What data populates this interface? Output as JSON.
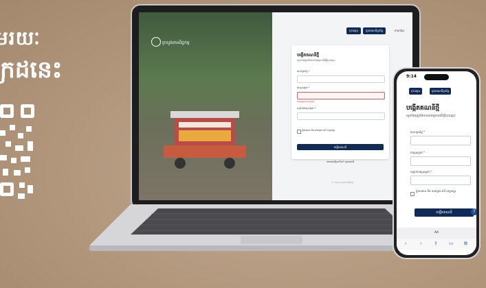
{
  "promo": {
    "line1": "មរយៈ",
    "line2": "ក្រដនេះ"
  },
  "laptop": {
    "photo_header": "ក្រសួងពាណិជ្ជកម្ម",
    "topbar": {
      "btn_primary": "ចុះឈ្មោះ",
      "btn_secondary": "ចូលគណនីប្រព័ន្ធ",
      "language": "ភាសាខ្មែរ"
    },
    "form": {
      "title": "បង្កើតគណនីថ្មី",
      "subtitle": "សូមបំពេញព័ត៌មានខាងក្រោមដើម្បីចុះឈ្មោះ",
      "field1_label": "លេខទូរស័ព្ទ *",
      "field2_label": "ពាក្យសម្ងាត់ *",
      "error_text": "សូមបញ្ចូលពាក្យសម្ងាត់",
      "field3_label": "បញ្ជាក់ពាក្យសម្ងាត់ *",
      "checkbox_label": "ខ្ញុំបានអាន និង យល់ព្រម លើ លក្ខខណ្ឌ",
      "submit": "បង្កើតគណនី",
      "login_prompt": "មានគណនីរួចហើយ? ចូលគណនី",
      "footer": "© 2024 ក្រសួងពាណិជ្ជកម្ម"
    }
  },
  "phone": {
    "time": "9:14",
    "btn_primary": "ចុះឈ្មោះ",
    "btn_secondary": "ចូលគណនីប្រព័ន្ធ",
    "title": "បង្កើតគណនីថ្មី",
    "subtitle": "សូមបំពេញព័ត៌មានខាងក្រោមដើម្បីចុះឈ្មោះ",
    "field1_label": "លេខទូរស័ព្ទ *",
    "field2_label": "ពាក្យសម្ងាត់ *",
    "field3_label": "បញ្ជាក់ពាក្យសម្ងាត់ *",
    "checkbox_label": "ខ្ញុំបានអាន និង យល់ព្រម លើ លក្ខខណ្ឌ",
    "submit": "បង្កើតគណនី",
    "url": "AA",
    "help": "?"
  },
  "colors": {
    "brand": "#0f2a55",
    "background": "#b49a80",
    "error": "#d13b3f"
  },
  "icons": [
    "logo-icon",
    "qr-code-icon",
    "help-icon",
    "share-icon",
    "bookmarks-icon",
    "tabs-icon",
    "reload-icon",
    "language-icon"
  ]
}
